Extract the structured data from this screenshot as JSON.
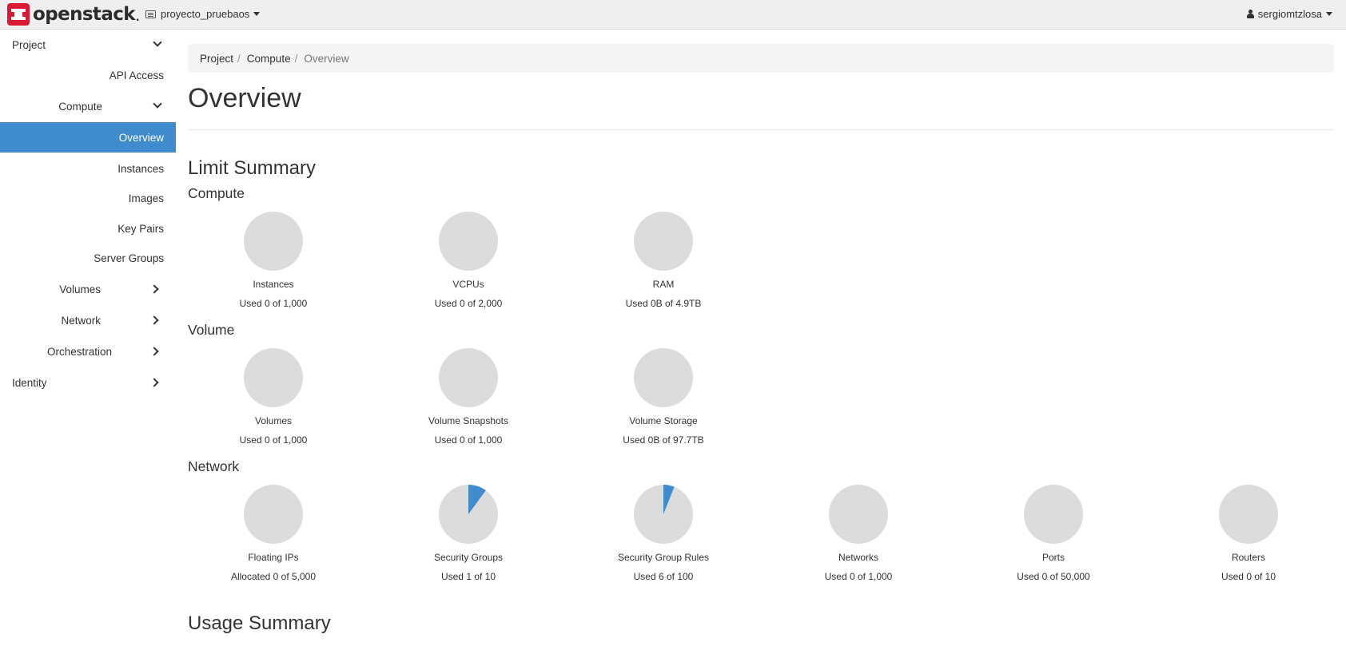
{
  "header": {
    "brand": "openstack",
    "brand_suffix": ".",
    "project": "proyecto_pruebaos",
    "user": "sergiomtzlosa"
  },
  "sidebar": {
    "project": "Project",
    "api_access": "API Access",
    "compute": "Compute",
    "overview": "Overview",
    "instances": "Instances",
    "images": "Images",
    "key_pairs": "Key Pairs",
    "server_groups": "Server Groups",
    "volumes": "Volumes",
    "network": "Network",
    "orchestration": "Orchestration",
    "identity": "Identity"
  },
  "breadcrumb": {
    "project": "Project",
    "compute": "Compute",
    "current": "Overview",
    "separator": "/"
  },
  "page": {
    "title": "Overview",
    "limit_summary": "Limit Summary",
    "usage_summary": "Usage Summary"
  },
  "colors": {
    "pie_base": "#dcdcdc",
    "pie_fill": "#3f8bcc",
    "active_nav": "#3f8bcc"
  },
  "limits": {
    "compute": {
      "title": "Compute",
      "items": [
        {
          "name": "Instances",
          "used": "Used 0 of 1,000",
          "fraction": 0
        },
        {
          "name": "VCPUs",
          "used": "Used 0 of 2,000",
          "fraction": 0
        },
        {
          "name": "RAM",
          "used": "Used 0B of 4.9TB",
          "fraction": 0
        }
      ]
    },
    "volume": {
      "title": "Volume",
      "items": [
        {
          "name": "Volumes",
          "used": "Used 0 of 1,000",
          "fraction": 0
        },
        {
          "name": "Volume Snapshots",
          "used": "Used 0 of 1,000",
          "fraction": 0
        },
        {
          "name": "Volume Storage",
          "used": "Used 0B of 97.7TB",
          "fraction": 0
        }
      ]
    },
    "network": {
      "title": "Network",
      "items": [
        {
          "name": "Floating IPs",
          "used": "Allocated 0 of 5,000",
          "fraction": 0
        },
        {
          "name": "Security Groups",
          "used": "Used 1 of 10",
          "fraction": 0.1
        },
        {
          "name": "Security Group Rules",
          "used": "Used 6 of 100",
          "fraction": 0.06
        },
        {
          "name": "Networks",
          "used": "Used 0 of 1,000",
          "fraction": 0
        },
        {
          "name": "Ports",
          "used": "Used 0 of 50,000",
          "fraction": 0
        },
        {
          "name": "Routers",
          "used": "Used 0 of 10",
          "fraction": 0
        }
      ]
    }
  }
}
